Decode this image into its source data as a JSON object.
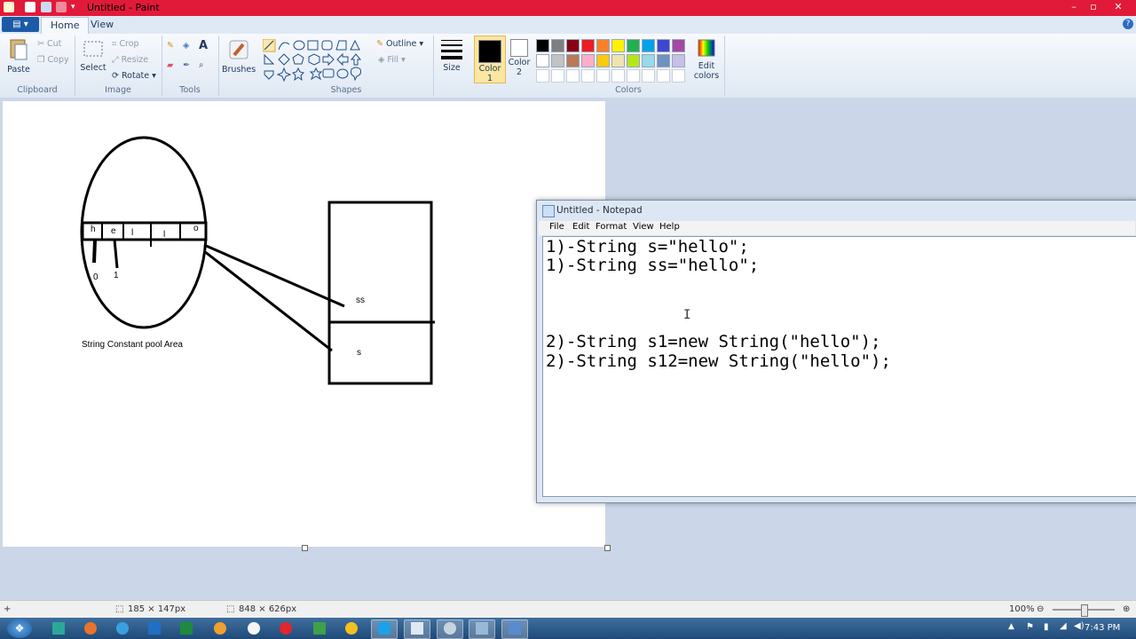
{
  "window": {
    "title": "Untitled - Paint"
  },
  "tabs": {
    "file": "",
    "home": "Home",
    "view": "View"
  },
  "ribbon": {
    "clipboard": {
      "label": "Clipboard",
      "paste": "Paste",
      "cut": "Cut",
      "copy": "Copy"
    },
    "image": {
      "label": "Image",
      "select": "Select",
      "crop": "Crop",
      "resize": "Resize",
      "rotate": "Rotate"
    },
    "tools": {
      "label": "Tools"
    },
    "brushes": "Brushes",
    "shapes": {
      "label": "Shapes",
      "outline": "Outline",
      "fill": "Fill"
    },
    "size": "Size",
    "color1": "Color\n1",
    "color1_a": "Color",
    "color1_b": "1",
    "color2_a": "Color",
    "color2_b": "2",
    "colors": {
      "label": "Colors",
      "edit_a": "Edit",
      "edit_b": "colors",
      "row1": [
        "#000000",
        "#7f7f7f",
        "#880015",
        "#ed1c24",
        "#ff7f27",
        "#fff200",
        "#22b14c",
        "#00a2e8",
        "#3f48cc",
        "#a349a4"
      ],
      "row2": [
        "#ffffff",
        "#c3c3c3",
        "#b97a57",
        "#ffaec9",
        "#ffc90e",
        "#efe4b0",
        "#b5e61d",
        "#99d9ea",
        "#7092be",
        "#c8bfe7"
      ]
    }
  },
  "drawing": {
    "letters": [
      "h",
      "e",
      "l",
      "l",
      "o"
    ],
    "indices": [
      "0",
      "1"
    ],
    "pool_label": "String Constant pool Area",
    "ref_ss": "ss",
    "ref_s": "s"
  },
  "notepad": {
    "title": "Untitled - Notepad",
    "menu": {
      "file": "File",
      "edit": "Edit",
      "format": "Format",
      "view": "View",
      "help": "Help"
    },
    "lines": [
      "1)-String s=\"hello\";",
      "1)-String ss=\"hello\";",
      "2)-String s1=new String(\"hello\");",
      "2)-String s12=new String(\"hello\");"
    ]
  },
  "status": {
    "selection": "185 × 147px",
    "canvas_size": "848 × 626px",
    "zoom": "100%",
    "zoom_fraction": 0.5
  },
  "taskbar": {
    "clock": "7:43 PM"
  }
}
